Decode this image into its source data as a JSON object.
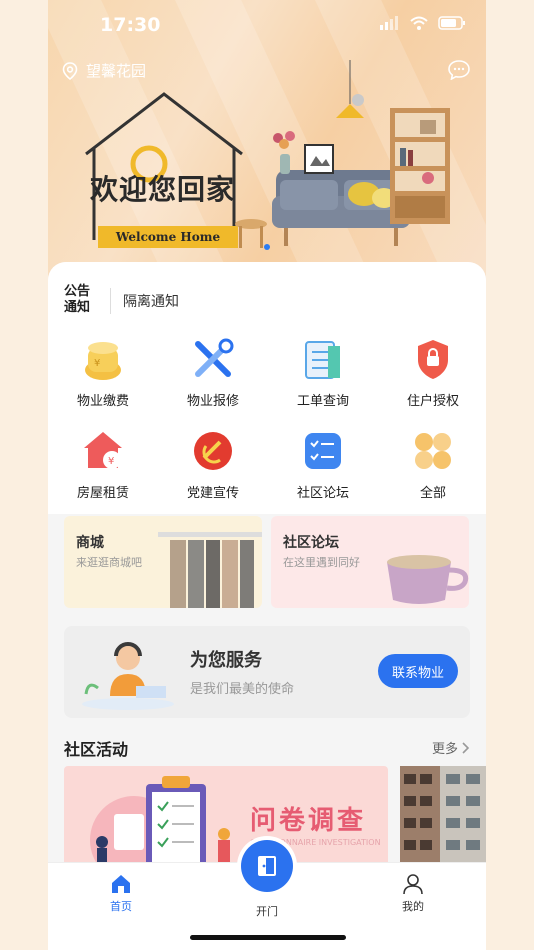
{
  "status": {
    "time": "17:30"
  },
  "header": {
    "location": "望馨花园"
  },
  "hero": {
    "welcome_cn": "欢迎您回家",
    "welcome_en": "Welcome Home"
  },
  "notice": {
    "label": "公告通知",
    "text": "隔离通知"
  },
  "grid": [
    {
      "label": "物业缴费",
      "icon": "property-fee-icon"
    },
    {
      "label": "物业报修",
      "icon": "repair-tools-icon"
    },
    {
      "label": "工单查询",
      "icon": "work-order-icon"
    },
    {
      "label": "住户授权",
      "icon": "shield-lock-icon"
    },
    {
      "label": "房屋租赁",
      "icon": "house-rent-icon"
    },
    {
      "label": "党建宣传",
      "icon": "party-emblem-icon"
    },
    {
      "label": "社区论坛",
      "icon": "forum-list-icon"
    },
    {
      "label": "全部",
      "icon": "all-grid-icon"
    }
  ],
  "promos": [
    {
      "title": "商城",
      "subtitle": "来逛逛商城吧"
    },
    {
      "title": "社区论坛",
      "subtitle": "在这里遇到同好"
    }
  ],
  "service": {
    "title": "为您服务",
    "subtitle": "是我们最美的使命",
    "button": "联系物业"
  },
  "activities": {
    "title": "社区活动",
    "more": "更多",
    "banner_title": "问卷调查",
    "banner_sub": "QUESTIONNAIRE INVESTIGATION"
  },
  "tabbar": {
    "home": "首页",
    "door": "开门",
    "mine": "我的"
  },
  "colors": {
    "accent": "#2b72ef",
    "hero_bg": "#f7d6ad"
  }
}
